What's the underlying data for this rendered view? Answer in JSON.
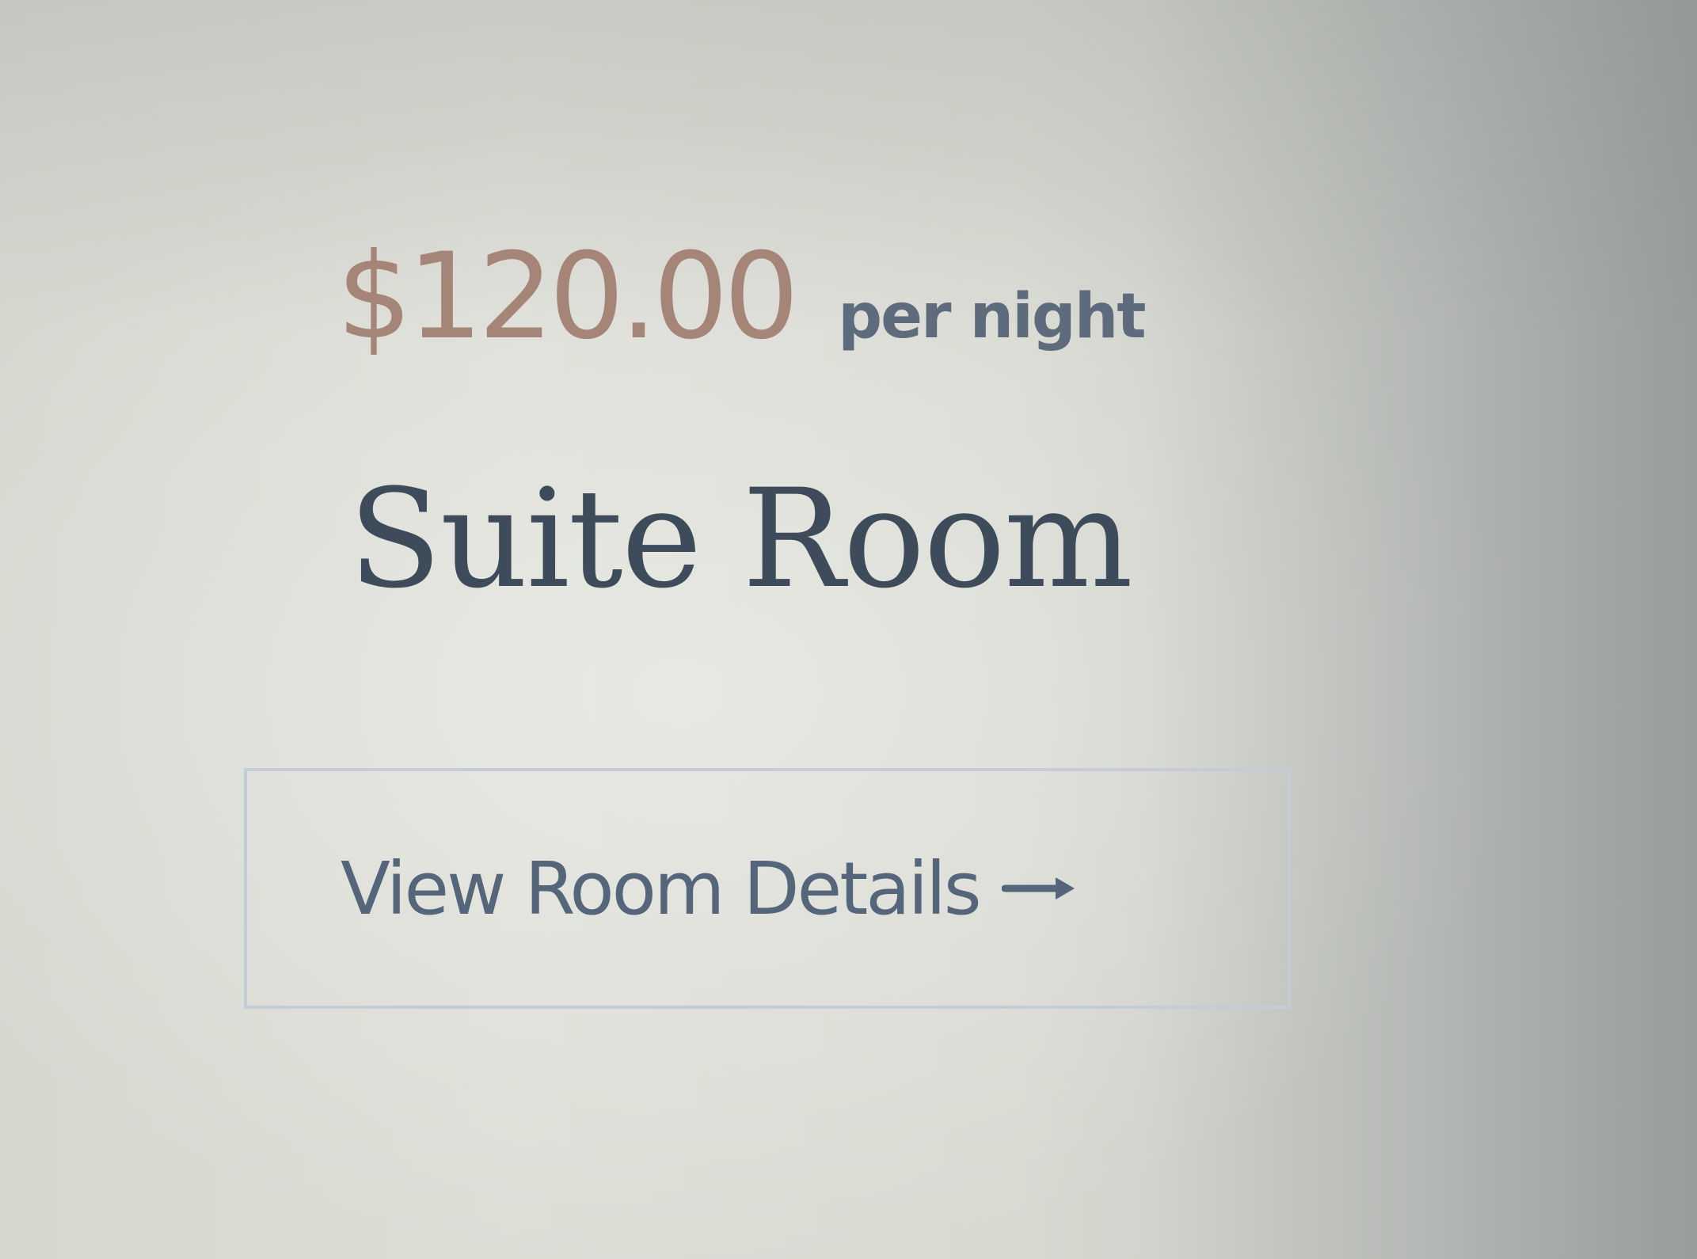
{
  "room_card": {
    "price": "$120.00",
    "price_unit": "per night",
    "room_name": "Suite Room",
    "details_button_label": "View Room Details",
    "details_button_icon": "arrow-right-icon"
  },
  "colors": {
    "price": "#a58577",
    "price_unit": "#5d6b7c",
    "room_name": "#3e4b5a",
    "button_text": "#56667a",
    "button_border": "#c4ccd6"
  }
}
